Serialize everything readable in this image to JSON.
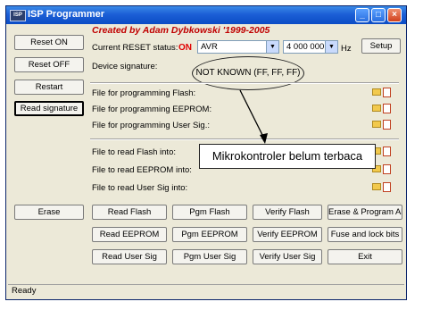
{
  "window": {
    "title": "ISP Programmer",
    "app_icon": "ISP"
  },
  "title_buttons": {
    "minimize": "_",
    "maximize": "□",
    "close": "×"
  },
  "header": {
    "created_by": "Created by Adam Dybkowski '1999-2005"
  },
  "left_buttons": {
    "reset_on": "Reset ON",
    "reset_off": "Reset OFF",
    "restart": "Restart",
    "read_signature": "Read signature"
  },
  "reset_row": {
    "label": "Current RESET status:",
    "status": "ON",
    "device": "AVR",
    "frequency": "4 000 000",
    "unit": "Hz",
    "setup": "Setup"
  },
  "signature": {
    "label": "Device signature:",
    "value": "NOT KNOWN (FF, FF, FF)"
  },
  "program_files": [
    "File for programming Flash:",
    "File for programming EEPROM:",
    "File for programming User Sig.:"
  ],
  "read_files": [
    "File to read Flash into:",
    "File to read EEPROM into:",
    "File to read User Sig into:"
  ],
  "annotation": "Mikrokontroler belum terbaca",
  "action_buttons": {
    "erase": "Erase",
    "row1": [
      "Read Flash",
      "Pgm Flash",
      "Verify Flash",
      "Erase & Program All"
    ],
    "row2": [
      "Read EEPROM",
      "Pgm EEPROM",
      "Verify EEPROM",
      "Fuse and lock bits"
    ],
    "row3": [
      "Read User Sig",
      "Pgm User Sig",
      "Verify User Sig",
      "Exit"
    ]
  },
  "status_bar": "Ready"
}
